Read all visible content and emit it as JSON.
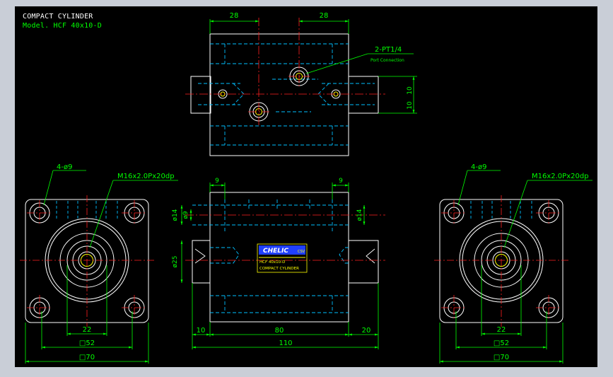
{
  "header": {
    "title": "COMPACT CYLINDER",
    "model": "Model. HCF 40x10-D"
  },
  "top_view": {
    "dim_left": "28",
    "dim_right": "28",
    "port_callout": "2-PT1/4",
    "port_sub": "Port Connection",
    "dim_v1": "10",
    "dim_v2": "10"
  },
  "left_view": {
    "holes": "4-ø9",
    "thread": "M16x2.0Px20dp",
    "dim_inner": "22",
    "dim_mid": "□52",
    "dim_outer": "□70"
  },
  "right_view": {
    "holes": "4-ø9",
    "thread": "M16x2.0Px20dp",
    "dim_inner": "22",
    "dim_mid": "□52",
    "dim_outer": "□70"
  },
  "front_view": {
    "dim_top_left": "9",
    "dim_top_right": "9",
    "dia_14_left": "ø14",
    "dia_9": "ø9",
    "dia_14_right": "ø14",
    "dia_25": "ø25",
    "dim_10": "10",
    "dim_80": "80",
    "dim_20": "20",
    "dim_110": "110",
    "label_brand": "CHELIC",
    "label_code": "CSV",
    "label_model": "HCF 40x10-D",
    "label_name": "COMPACT CYLINDER"
  },
  "colors": {
    "background": "#000000",
    "outline": "#ffffff",
    "hidden": "#00bfff",
    "center": "#ff2020",
    "dimension": "#00ff00",
    "hatch": "#ffff00"
  }
}
